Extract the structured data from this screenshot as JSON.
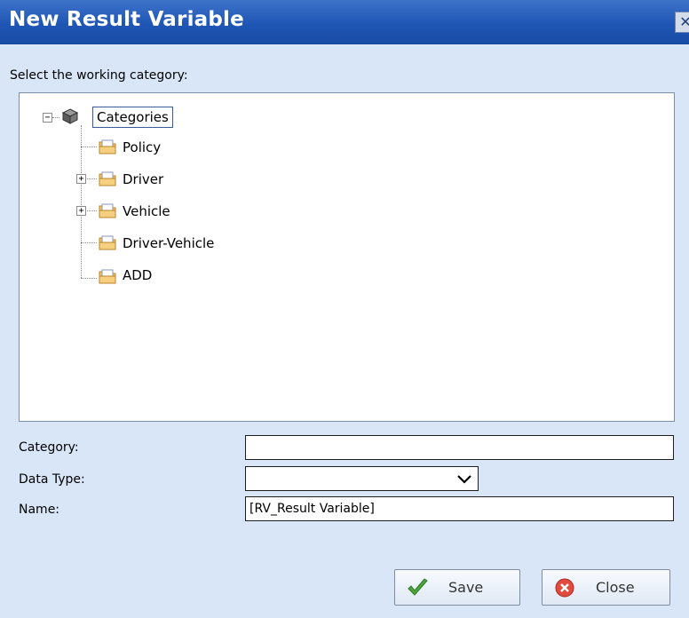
{
  "window": {
    "title": "New Result Variable",
    "close_icon": "close-icon"
  },
  "tree": {
    "section_label": "Select the working category:",
    "root": {
      "label": "Categories",
      "expanded": true,
      "icon": "cube-icon"
    },
    "children": [
      {
        "label": "Policy",
        "expandable": false,
        "icon": "folder-icon"
      },
      {
        "label": "Driver",
        "expandable": true,
        "icon": "folder-icon"
      },
      {
        "label": "Vehicle",
        "expandable": true,
        "icon": "folder-icon"
      },
      {
        "label": "Driver-Vehicle",
        "expandable": false,
        "icon": "folder-icon"
      },
      {
        "label": "ADD",
        "expandable": false,
        "icon": "folder-icon"
      }
    ]
  },
  "form": {
    "category_label": "Category:",
    "category_value": "",
    "data_type_label": "Data Type:",
    "data_type_value": "",
    "name_label": "Name:",
    "name_value": "[RV_Result Variable]"
  },
  "buttons": {
    "save_label": "Save",
    "close_label": "Close"
  },
  "colors": {
    "titlebar": "#1f56b5",
    "dialog_bg": "#d8e6f8"
  }
}
